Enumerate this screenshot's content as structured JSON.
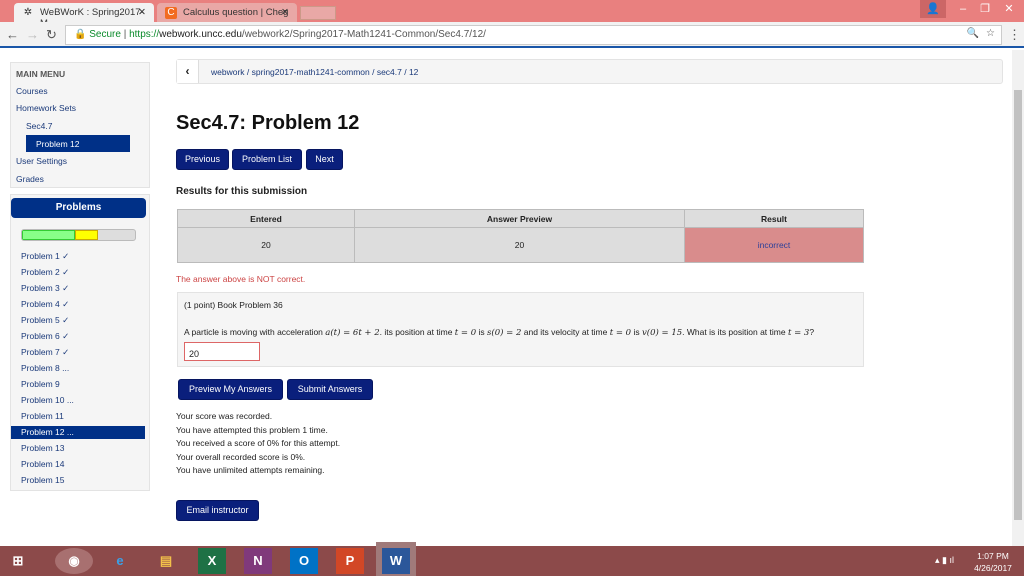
{
  "browser": {
    "tabs": [
      {
        "title": "WeBWorK : Spring2017-M"
      },
      {
        "title": "Calculus question | Cheg"
      }
    ],
    "secure_label": "Secure",
    "url_scheme": "https://",
    "url_host": "webwork.uncc.edu",
    "url_path": "/webwork2/Spring2017-Math1241-Common/Sec4.7/12/"
  },
  "sidebar": {
    "main_menu": "MAIN MENU",
    "items": [
      "Courses",
      "Homework Sets",
      "Sec4.7",
      "Problem 12",
      "User Settings",
      "Grades"
    ],
    "problems_title": "Problems",
    "progress": {
      "correct_fraction": 0.47,
      "partial_fraction": 0.2,
      "correct_color": "#88ff88",
      "partial_color": "#ffff00"
    },
    "problems": [
      "Problem 1 ✓",
      "Problem 2 ✓",
      "Problem 3 ✓",
      "Problem 4 ✓",
      "Problem 5 ✓",
      "Problem 6 ✓",
      "Problem 7 ✓",
      "Problem 8 ...",
      "Problem 9",
      "Problem 10 ...",
      "Problem 11",
      "Problem 12 ...",
      "Problem 13",
      "Problem 14",
      "Problem 15"
    ]
  },
  "breadcrumb": "webwork / spring2017-math1241-common / sec4.7 / 12",
  "title": "Sec4.7: Problem 12",
  "nav": {
    "previous": "Previous",
    "list": "Problem List",
    "next": "Next"
  },
  "results": {
    "heading": "Results for this submission",
    "headers": [
      "Entered",
      "Answer Preview",
      "Result"
    ],
    "row": [
      "20",
      "20",
      "incorrect"
    ],
    "message": "The answer above is NOT correct."
  },
  "problem": {
    "header": "(1 point) Book Problem 36",
    "text1": "A particle is moving with acceleration ",
    "eq1": "a(t) = 6t + 2",
    "text2": ". its position at time ",
    "eq2": "t = 0",
    "text3": " is ",
    "eq3": "s(0) = 2",
    "text4": " and its velocity at time ",
    "eq4": "t = 0",
    "text5": " is ",
    "eq5": "v(0) = 15",
    "text6": ". What is its position at time ",
    "eq6": "t = 3",
    "text7": "? ",
    "answer": "20"
  },
  "actions": {
    "preview": "Preview My Answers",
    "submit": "Submit Answers",
    "email": "Email instructor"
  },
  "messages": [
    "Your score was recorded.",
    "You have attempted this problem 1 time.",
    "You received a score of 0% for this attempt.",
    "Your overall recorded score is 0%.",
    "You have unlimited attempts remaining."
  ],
  "taskbar": {
    "time": "1:07 PM",
    "date": "4/26/2017"
  }
}
